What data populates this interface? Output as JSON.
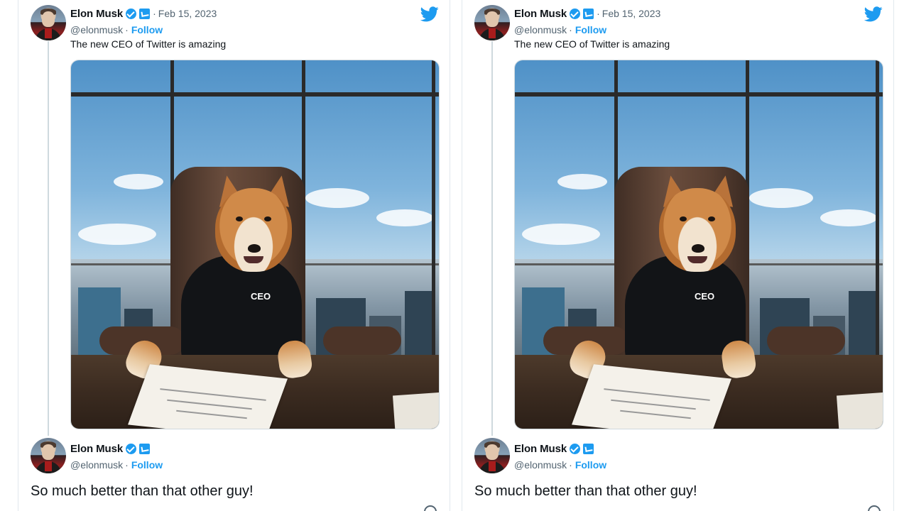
{
  "tweets": [
    {
      "author": {
        "display_name": "Elon Musk",
        "handle": "@elonmusk",
        "date": "Feb 15, 2023",
        "follow_label": "Follow",
        "separator": "·"
      },
      "text": "The new CEO of Twitter is amazing",
      "image": {
        "sweater_label": "CEO"
      },
      "reply": {
        "display_name": "Elon Musk",
        "handle": "@elonmusk",
        "follow_label": "Follow",
        "separator": "·",
        "text": "So much better than that other guy!"
      }
    },
    {
      "author": {
        "display_name": "Elon Musk",
        "handle": "@elonmusk",
        "date": "Feb 15, 2023",
        "follow_label": "Follow",
        "separator": "·"
      },
      "text": "The new CEO of Twitter is amazing",
      "image": {
        "sweater_label": "CEO"
      },
      "reply": {
        "display_name": "Elon Musk",
        "handle": "@elonmusk",
        "follow_label": "Follow",
        "separator": "·",
        "text": "So much better than that other guy!"
      }
    }
  ],
  "icons": {
    "brand": "twitter-bird-icon",
    "verified": "verified-badge-icon",
    "affiliate": "twitter-affiliate-icon",
    "more": "info-circle-icon"
  },
  "colors": {
    "accent": "#1d9bf0",
    "text": "#0f1419",
    "muted": "#536471",
    "border": "#e1e8ed"
  }
}
